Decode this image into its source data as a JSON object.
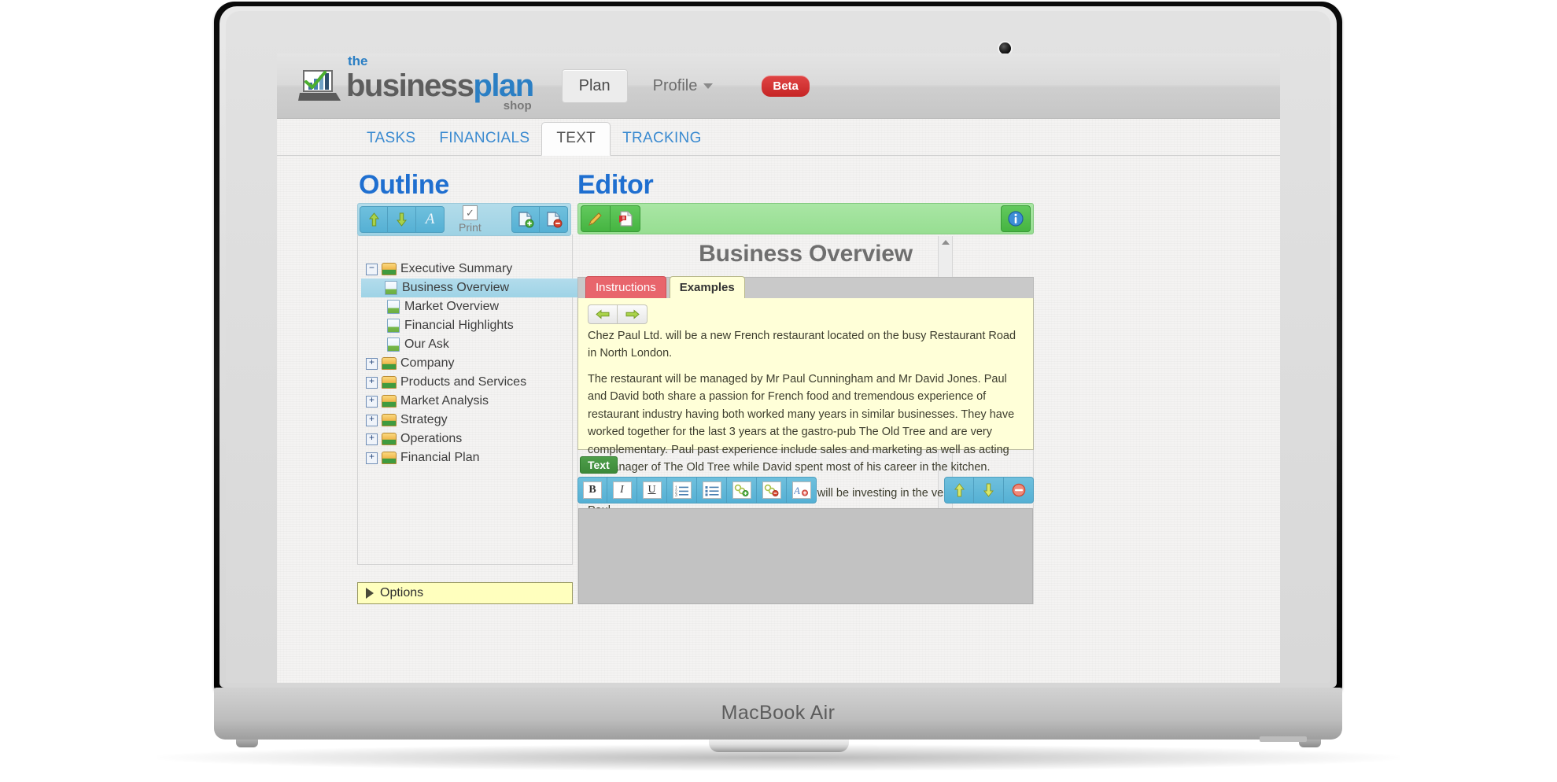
{
  "device": {
    "label": "MacBook Air"
  },
  "brand": {
    "the": "the",
    "business": "business",
    "plan": "plan",
    "shop": "shop",
    "logo_icon": "laptop-chart-icon"
  },
  "topnav": {
    "plan_label": "Plan",
    "profile_label": "Profile",
    "beta_label": "Beta",
    "caret_icon": "chevron-down-icon"
  },
  "main_tabs": [
    {
      "label": "TASKS",
      "active": false
    },
    {
      "label": "FINANCIALS",
      "active": false
    },
    {
      "label": "TEXT",
      "active": true
    },
    {
      "label": "TRACKING",
      "active": false
    }
  ],
  "outline": {
    "title": "Outline",
    "toolbar": {
      "move_up_icon": "arrow-up-icon",
      "move_down_icon": "arrow-down-icon",
      "rename_icon": "font-letter-a-icon",
      "print_label": "Print",
      "print_checked": true,
      "print_check_glyph": "✓",
      "add_page_icon": "document-add-icon",
      "delete_page_icon": "document-delete-icon"
    },
    "tree": [
      {
        "label": "Executive Summary",
        "type": "folder",
        "expander": "−",
        "level": 0,
        "selected": false
      },
      {
        "label": "Business Overview",
        "type": "doc",
        "level": 1,
        "selected": true
      },
      {
        "label": "Market Overview",
        "type": "doc",
        "level": 1,
        "selected": false
      },
      {
        "label": "Financial Highlights",
        "type": "doc",
        "level": 1,
        "selected": false
      },
      {
        "label": "Our Ask",
        "type": "doc",
        "level": 1,
        "selected": false
      },
      {
        "label": "Company",
        "type": "folder",
        "expander": "+",
        "level": 0,
        "selected": false
      },
      {
        "label": "Products and Services",
        "type": "folder",
        "expander": "+",
        "level": 0,
        "selected": false
      },
      {
        "label": "Market Analysis",
        "type": "folder",
        "expander": "+",
        "level": 0,
        "selected": false
      },
      {
        "label": "Strategy",
        "type": "folder",
        "expander": "+",
        "level": 0,
        "selected": false
      },
      {
        "label": "Operations",
        "type": "folder",
        "expander": "+",
        "level": 0,
        "selected": false
      },
      {
        "label": "Financial Plan",
        "type": "folder",
        "expander": "+",
        "level": 0,
        "selected": false
      }
    ],
    "options_label": "Options",
    "options_toggle_icon": "triangle-right-icon",
    "scrollbar": {
      "up_icon": "scroll-up-arrow-icon",
      "down_icon": "scroll-down-arrow-icon"
    }
  },
  "editor": {
    "title": "Editor",
    "toolbar": {
      "edit_icon": "pencil-edit-icon",
      "pdf_icon": "pdf-export-icon",
      "info_icon": "info-circle-icon"
    },
    "document_title": "Business Overview",
    "tabs": [
      {
        "label": "Instructions",
        "active": false
      },
      {
        "label": "Examples",
        "active": true
      }
    ],
    "example_nav": {
      "prev_icon": "arrow-left-icon",
      "next_icon": "arrow-right-icon"
    },
    "example_paragraphs": [
      "Chez Paul Ltd. will be a new French restaurant located on the busy Restaurant Road in North London.",
      "The restaurant will be managed by Mr Paul Cunningham and Mr David Jones. Paul and David both share a passion for French food and tremendous experience of restaurant industry having both worked many years in similar businesses. They have worked together for the last 3 years at the gastro-pub The Old Tree and are very complementary. Paul past experience include sales and marketing as well as acting as manager of The Old Tree while David spent most of his career in the kitchen.",
      "Ms Sarah James, a friend of David and Paul, will be investing in the venture alongside Paul."
    ],
    "text_section": {
      "badge_label": "Text",
      "format_buttons": [
        {
          "name": "bold-button",
          "glyph": "B"
        },
        {
          "name": "italic-button",
          "glyph": "I"
        },
        {
          "name": "underline-button",
          "glyph": "U"
        },
        {
          "name": "ordered-list-button",
          "glyph": "≔"
        },
        {
          "name": "bullet-list-button",
          "glyph": "☰"
        },
        {
          "name": "add-link-button",
          "glyph": "⚭"
        },
        {
          "name": "remove-link-button",
          "glyph": "⚯"
        },
        {
          "name": "text-style-button",
          "glyph": "A"
        }
      ],
      "move_up_icon": "arrow-up-icon",
      "move_down_icon": "arrow-down-icon",
      "delete_icon": "delete-circle-icon",
      "content": ""
    }
  },
  "colors": {
    "accent_blue": "#1f6fd0",
    "link_blue": "#3a8ad0",
    "toolbar_blue": "#55b0d4",
    "toolbar_green": "#45b441",
    "instructions_red": "#e8656c",
    "examples_yellow": "#ffffd8",
    "options_yellow": "#ffffbe",
    "beta_red": "#c62525",
    "editor_area_gray": "#c2c2c2"
  }
}
